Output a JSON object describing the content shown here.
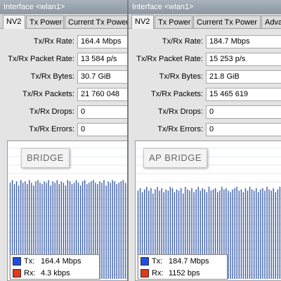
{
  "colors": {
    "tx": "#1f4fe0",
    "rx": "#e03a1a",
    "bar": "#3a5da8",
    "grid": "#c8d4e8"
  },
  "left": {
    "title": "Interface <wlan1>",
    "tabs": [
      {
        "label": "NV2"
      },
      {
        "label": "Tx Power"
      },
      {
        "label": "Current Tx Power"
      }
    ],
    "fields": [
      {
        "label": "Tx/Rx Rate:",
        "value": "164.4 Mbps"
      },
      {
        "label": "Tx/Rx Packet Rate:",
        "value": "13 584 p/s"
      },
      {
        "label": "Tx/Rx Bytes:",
        "value": "30.7 GiB"
      },
      {
        "label": "Tx/Rx Packets:",
        "value": "21 760 048"
      },
      {
        "label": "Tx/Rx Drops:",
        "value": "0"
      },
      {
        "label": "Tx/Rx Errors:",
        "value": "0"
      }
    ],
    "mode_label": "BRIDGE",
    "legend": {
      "tx_label": "Tx:",
      "tx_value": "164.4 Mbps",
      "rx_label": "Rx:",
      "rx_value": "4.3 kbps"
    },
    "graph": {
      "tx_level": 0.72,
      "tx_series": [
        0.72,
        0.74,
        0.71,
        0.73,
        0.7,
        0.74,
        0.72,
        0.73,
        0.71,
        0.74,
        0.72,
        0.7,
        0.73,
        0.74,
        0.72,
        0.71,
        0.73,
        0.72,
        0.74,
        0.7,
        0.73,
        0.72,
        0.74,
        0.71,
        0.73,
        0.72,
        0.7,
        0.74,
        0.73,
        0.71,
        0.72,
        0.74,
        0.72,
        0.7,
        0.73,
        0.74,
        0.71,
        0.72,
        0.73,
        0.74,
        0.72,
        0.71,
        0.73,
        0.72,
        0.74,
        0.7,
        0.73,
        0.72,
        0.74,
        0.73,
        0.71,
        0.72,
        0.73,
        0.74,
        0.72,
        0.71,
        0.73,
        0.72
      ]
    }
  },
  "right": {
    "title": "Interface <wlan1>",
    "tabs": [
      {
        "label": "NV2"
      },
      {
        "label": "Tx Power"
      },
      {
        "label": "Current Tx Power"
      },
      {
        "label": "Adva"
      }
    ],
    "fields": [
      {
        "label": "Tx/Rx Rate:",
        "value": "184.7 Mbps"
      },
      {
        "label": "Tx/Rx Packet Rate:",
        "value": "15 253 p/s"
      },
      {
        "label": "Tx/Rx Bytes:",
        "value": "21.8 GiB"
      },
      {
        "label": "Tx/Rx Packets:",
        "value": "15 465 619"
      },
      {
        "label": "Tx/Rx Drops:",
        "value": "0"
      },
      {
        "label": "Tx/Rx Errors:",
        "value": "0"
      }
    ],
    "mode_label": "AP BRIDGE",
    "legend": {
      "tx_label": "Tx:",
      "tx_value": "184.7 Mbps",
      "rx_label": "Rx:",
      "rx_value": "1152 bps"
    },
    "graph": {
      "tx_level": 0.66,
      "tx_series": [
        0.66,
        0.68,
        0.65,
        0.67,
        0.69,
        0.66,
        0.68,
        0.64,
        0.67,
        0.69,
        0.66,
        0.68,
        0.65,
        0.67,
        0.66,
        0.69,
        0.68,
        0.65,
        0.67,
        0.66,
        0.68,
        0.64,
        0.69,
        0.67,
        0.66,
        0.68,
        0.65,
        0.67,
        0.69,
        0.66,
        0.68,
        0.67,
        0.65,
        0.69,
        0.66,
        0.67,
        0.68,
        0.65,
        0.66,
        0.69,
        0.67,
        0.68,
        0.66,
        0.65,
        0.67,
        0.68,
        0.69,
        0.66,
        0.67,
        0.65,
        0.68,
        0.66,
        0.69,
        0.67,
        0.66,
        0.68,
        0.65,
        0.67,
        0.68,
        0.66,
        0.69,
        0.67,
        0.66,
        0.68,
        0.65,
        0.67,
        0.69,
        0.66
      ]
    }
  }
}
